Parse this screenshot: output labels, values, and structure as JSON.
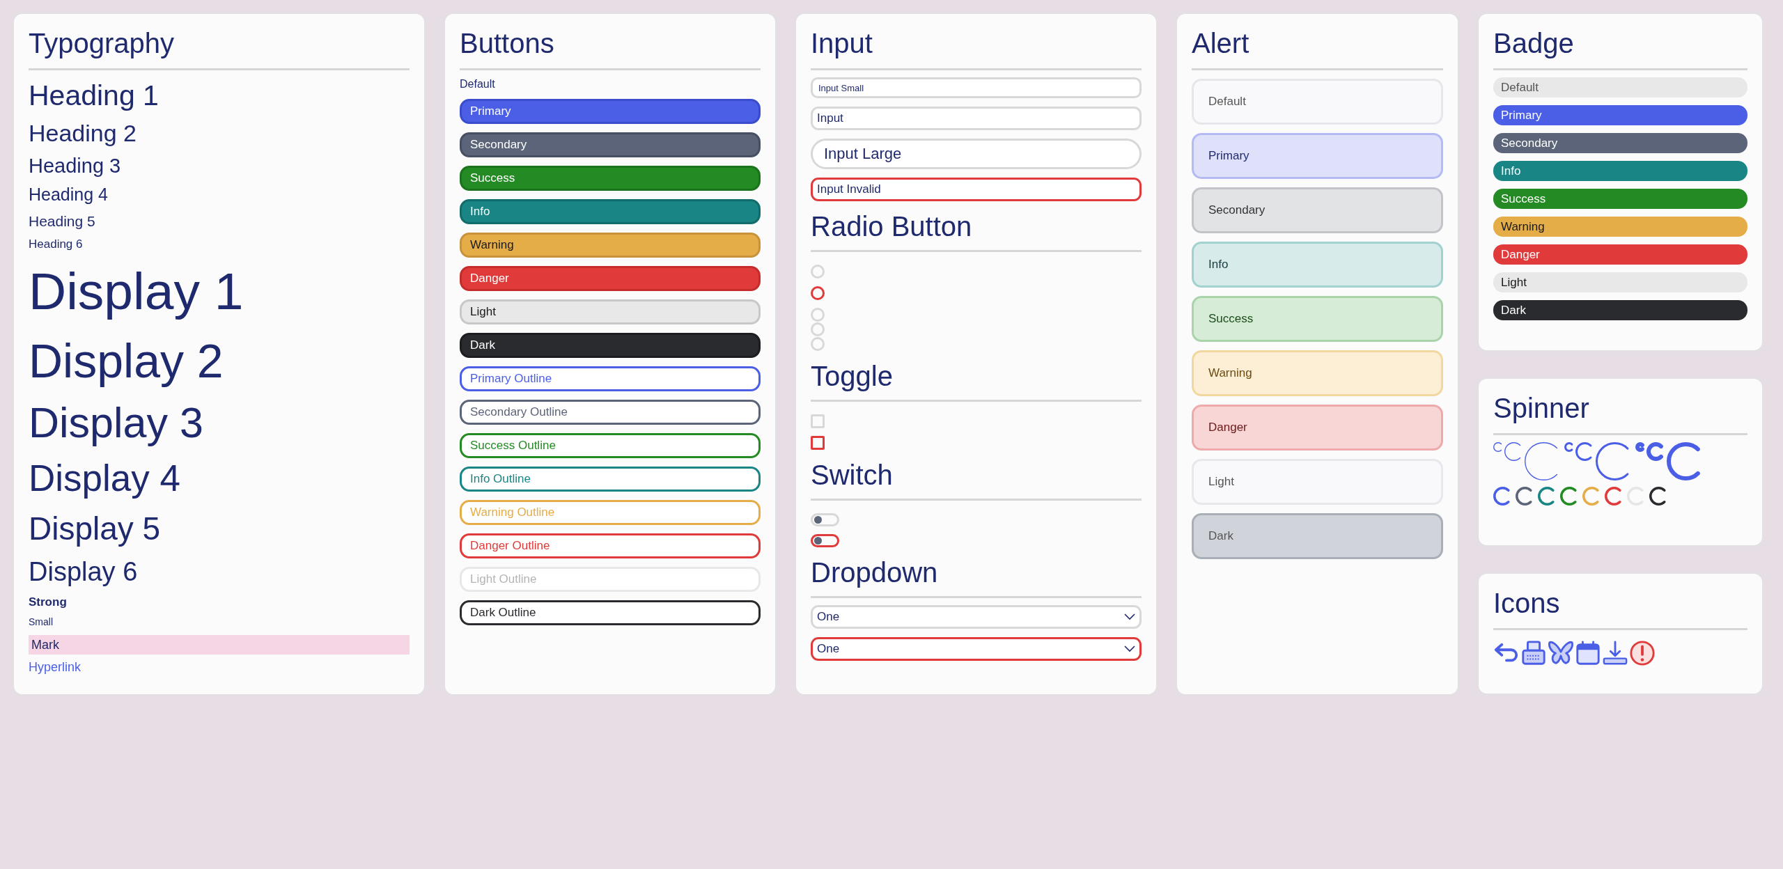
{
  "typography": {
    "title": "Typography",
    "items": [
      {
        "kind": "h1",
        "text": "Heading 1"
      },
      {
        "kind": "h2",
        "text": "Heading 2"
      },
      {
        "kind": "h3",
        "text": "Heading 3"
      },
      {
        "kind": "h4",
        "text": "Heading 4"
      },
      {
        "kind": "h5",
        "text": "Heading 5"
      },
      {
        "kind": "h6",
        "text": "Heading 6"
      },
      {
        "kind": "display1",
        "text": "Display 1"
      },
      {
        "kind": "display2",
        "text": "Display 2"
      },
      {
        "kind": "display3",
        "text": "Display 3"
      },
      {
        "kind": "display4",
        "text": "Display 4"
      },
      {
        "kind": "display5",
        "text": "Display 5"
      },
      {
        "kind": "display6",
        "text": "Display 6"
      },
      {
        "kind": "strong",
        "text": "Strong"
      },
      {
        "kind": "small",
        "text": "Small"
      },
      {
        "kind": "mark",
        "text": "Mark"
      },
      {
        "kind": "link",
        "text": "Hyperlink"
      }
    ]
  },
  "buttons": {
    "title": "Buttons",
    "label": "Default",
    "items": [
      {
        "label": "Primary",
        "kind": "primary",
        "outline": false
      },
      {
        "label": "Secondary",
        "kind": "secondary",
        "outline": false
      },
      {
        "label": "Success",
        "kind": "success",
        "outline": false
      },
      {
        "label": "Info",
        "kind": "info",
        "outline": false
      },
      {
        "label": "Warning",
        "kind": "warning",
        "outline": false
      },
      {
        "label": "Danger",
        "kind": "danger",
        "outline": false
      },
      {
        "label": "Light",
        "kind": "light",
        "outline": false
      },
      {
        "label": "Dark",
        "kind": "dark",
        "outline": false
      },
      {
        "label": "Primary Outline",
        "kind": "primary",
        "outline": true
      },
      {
        "label": "Secondary Outline",
        "kind": "secondary",
        "outline": true
      },
      {
        "label": "Success Outline",
        "kind": "success",
        "outline": true
      },
      {
        "label": "Info Outline",
        "kind": "info",
        "outline": true
      },
      {
        "label": "Warning Outline",
        "kind": "warning",
        "outline": true
      },
      {
        "label": "Danger Outline",
        "kind": "danger",
        "outline": true
      },
      {
        "label": "Light Outline",
        "kind": "light",
        "outline": true
      },
      {
        "label": "Dark Outline",
        "kind": "dark",
        "outline": true
      }
    ]
  },
  "input": {
    "title": "Input",
    "fields": [
      {
        "kind": "small",
        "value": "Input Small"
      },
      {
        "kind": "normal",
        "value": "Input"
      },
      {
        "kind": "large",
        "value": "Input Large"
      },
      {
        "kind": "invalid",
        "value": "Input Invalid"
      }
    ]
  },
  "radio": {
    "title": "Radio Button",
    "items": [
      {
        "selected": false,
        "kind": "valid"
      },
      {
        "selected": false,
        "kind": "invalid"
      },
      {
        "selected": false,
        "kind": "valid"
      },
      {
        "selected": false,
        "kind": "valid"
      },
      {
        "selected": false,
        "kind": "valid"
      }
    ]
  },
  "toggle": {
    "title": "Toggle",
    "items": [
      {
        "checked": false,
        "kind": "valid"
      },
      {
        "checked": false,
        "kind": "invalid"
      }
    ]
  },
  "switch": {
    "title": "Switch",
    "items": [
      {
        "on": false,
        "kind": "valid"
      },
      {
        "on": false,
        "kind": "invalid"
      }
    ]
  },
  "dropdown": {
    "title": "Dropdown",
    "items": [
      {
        "value": "One",
        "kind": "valid"
      },
      {
        "value": "One",
        "kind": "invalid"
      }
    ]
  },
  "alert": {
    "title": "Alert",
    "items": [
      {
        "text": "Default",
        "kind": "default"
      },
      {
        "text": "Primary",
        "kind": "primary"
      },
      {
        "text": "Secondary",
        "kind": "secondary"
      },
      {
        "text": "Info",
        "kind": "info"
      },
      {
        "text": "Success",
        "kind": "success"
      },
      {
        "text": "Warning",
        "kind": "warning"
      },
      {
        "text": "Danger",
        "kind": "danger"
      },
      {
        "text": "Light",
        "kind": "light"
      },
      {
        "text": "Dark",
        "kind": "dark"
      }
    ]
  },
  "badge": {
    "title": "Badge",
    "items": [
      {
        "text": "Default",
        "kind": "default"
      },
      {
        "text": "Primary",
        "kind": "primary"
      },
      {
        "text": "Secondary",
        "kind": "secondary"
      },
      {
        "text": "Info",
        "kind": "info"
      },
      {
        "text": "Success",
        "kind": "success"
      },
      {
        "text": "Warning",
        "kind": "warning"
      },
      {
        "text": "Danger",
        "kind": "danger"
      },
      {
        "text": "Light",
        "kind": "light"
      },
      {
        "text": "Dark",
        "kind": "dark"
      }
    ]
  },
  "spinner": {
    "title": "Spinner",
    "items": [
      {
        "color": "#4a5ee6"
      },
      {
        "color": "#5b6478"
      },
      {
        "color": "#1a8585"
      },
      {
        "color": "#248a24"
      },
      {
        "color": "#e5ad48"
      },
      {
        "color": "#e03a3a"
      },
      {
        "color": "#e6e6e6"
      },
      {
        "color": "#2a2b2f"
      }
    ]
  },
  "icons": {
    "title": "Icons"
  }
}
